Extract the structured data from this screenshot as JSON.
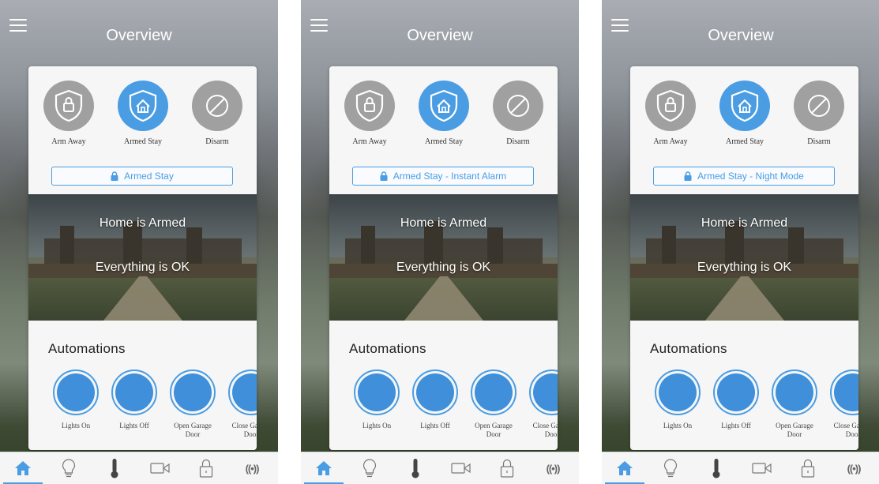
{
  "screens": [
    {
      "header": {
        "title": "Overview"
      },
      "modes": [
        {
          "label": "Arm Away",
          "icon": "shield-lock-icon",
          "active": false
        },
        {
          "label": "Armed Stay",
          "icon": "shield-home-icon",
          "active": true
        },
        {
          "label": "Disarm",
          "icon": "disarm-icon",
          "active": false
        }
      ],
      "status": {
        "label": "Armed Stay"
      },
      "hero": {
        "line1": "Home is Armed",
        "line2": "Everything is OK"
      },
      "automations": {
        "title": "Automations",
        "items": [
          {
            "label": "Lights On"
          },
          {
            "label": "Lights Off"
          },
          {
            "label": "Open Garage Door"
          },
          {
            "label": "Close Garage Door"
          }
        ]
      }
    },
    {
      "header": {
        "title": "Overview"
      },
      "modes": [
        {
          "label": "Arm Away",
          "icon": "shield-lock-icon",
          "active": false
        },
        {
          "label": "Armed Stay",
          "icon": "shield-home-icon",
          "active": true
        },
        {
          "label": "Disarm",
          "icon": "disarm-icon",
          "active": false
        }
      ],
      "status": {
        "label": "Armed Stay - Instant Alarm"
      },
      "hero": {
        "line1": "Home is Armed",
        "line2": "Everything is OK"
      },
      "automations": {
        "title": "Automations",
        "items": [
          {
            "label": "Lights On"
          },
          {
            "label": "Lights Off"
          },
          {
            "label": "Open Garage Door"
          },
          {
            "label": "Close Garage Door"
          }
        ]
      }
    },
    {
      "header": {
        "title": "Overview"
      },
      "modes": [
        {
          "label": "Arm Away",
          "icon": "shield-lock-icon",
          "active": false
        },
        {
          "label": "Armed Stay",
          "icon": "shield-home-icon",
          "active": true
        },
        {
          "label": "Disarm",
          "icon": "disarm-icon",
          "active": false
        }
      ],
      "status": {
        "label": "Armed Stay - Night Mode"
      },
      "hero": {
        "line1": "Home is Armed",
        "line2": "Everything is OK"
      },
      "automations": {
        "title": "Automations",
        "items": [
          {
            "label": "Lights On"
          },
          {
            "label": "Lights Off"
          },
          {
            "label": "Open Garage Door"
          },
          {
            "label": "Close Garage Door"
          }
        ]
      }
    }
  ],
  "tabbar": {
    "tabs": [
      {
        "icon": "home-icon",
        "active": true
      },
      {
        "icon": "lightbulb-icon",
        "active": false
      },
      {
        "icon": "thermometer-icon",
        "active": false
      },
      {
        "icon": "camera-icon",
        "active": false
      },
      {
        "icon": "lock-icon",
        "active": false
      },
      {
        "icon": "sensor-icon",
        "text": "((•))",
        "active": false
      }
    ]
  },
  "colors": {
    "accent": "#4a9de2",
    "inactive": "#a0a0a0"
  }
}
